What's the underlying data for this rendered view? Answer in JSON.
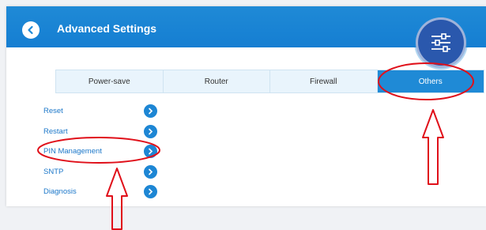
{
  "header": {
    "title": "Advanced Settings"
  },
  "icons": {
    "back": "chevron-left-icon",
    "settings": "sliders-icon",
    "menu_arrow": "chevron-right-icon"
  },
  "tabs": [
    {
      "label": "Power-save",
      "active": false
    },
    {
      "label": "Router",
      "active": false
    },
    {
      "label": "Firewall",
      "active": false
    },
    {
      "label": "Others",
      "active": true
    }
  ],
  "menu": {
    "items": [
      {
        "label": "Reset"
      },
      {
        "label": "Restart"
      },
      {
        "label": "PIN Management"
      },
      {
        "label": "SNTP"
      },
      {
        "label": "Diagnosis"
      }
    ]
  },
  "colors": {
    "header_blue": "#1f8ad6",
    "accent_blue": "#1d86d4",
    "badge_blue": "#2a58ad",
    "annotation_red": "#e0101a"
  }
}
